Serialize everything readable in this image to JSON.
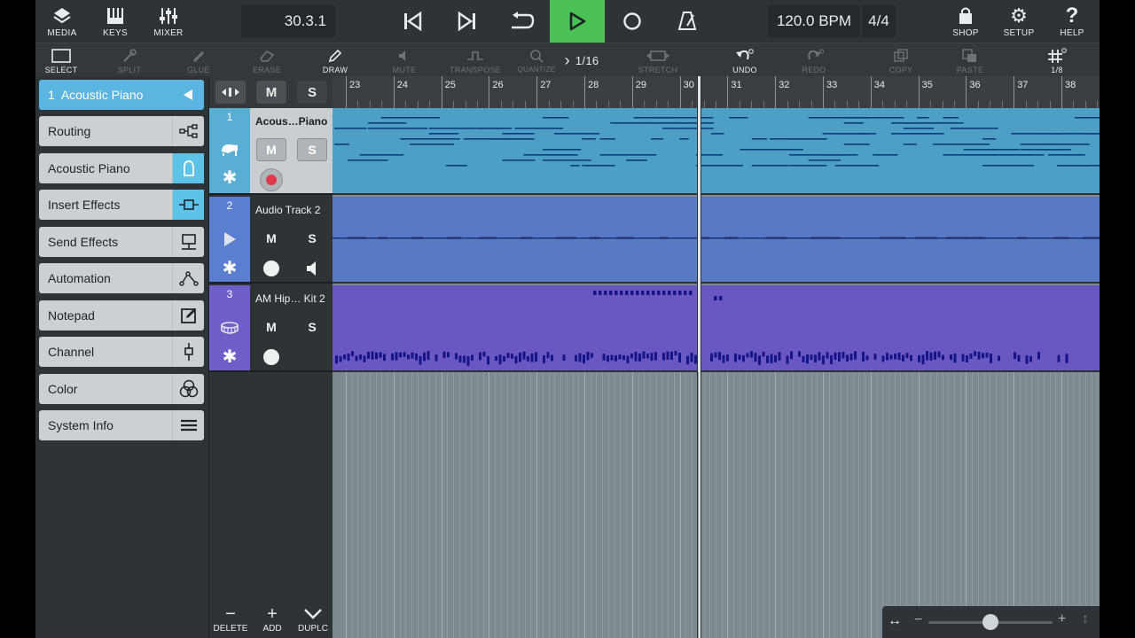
{
  "topbar": {
    "media": "MEDIA",
    "keys": "KEYS",
    "mixer": "MIXER",
    "position": "30.3.1",
    "tempo": "120.0 BPM",
    "signature": "4/4",
    "shop": "SHOP",
    "setup": "SETUP",
    "help": "HELP"
  },
  "toolbar": {
    "select": "SELECT",
    "split": "SPLIT",
    "glue": "GLUE",
    "erase": "ERASE",
    "draw": "DRAW",
    "mute": "MUTE",
    "transpose": "TRANSPOSE",
    "quantize": "QUANTIZE",
    "quantize_value": "1/16",
    "stretch": "STRETCH",
    "undo": "UNDO",
    "redo": "REDO",
    "copy": "COPY",
    "paste": "PASTE",
    "grid_value": "1/8"
  },
  "inspector": {
    "track_number": "1",
    "track_name": "Acoustic Piano",
    "items": [
      {
        "label": "Routing"
      },
      {
        "label": "Acoustic Piano"
      },
      {
        "label": "Insert Effects"
      },
      {
        "label": "Send Effects"
      },
      {
        "label": "Automation"
      },
      {
        "label": "Notepad"
      },
      {
        "label": "Channel"
      },
      {
        "label": "Color"
      },
      {
        "label": "System Info"
      }
    ]
  },
  "track_header": {
    "mute_all": "M",
    "solo_all": "S"
  },
  "tracks": [
    {
      "number": "1",
      "name": "Acous…Piano",
      "mute": "M",
      "solo": "S",
      "color": "#5aaed4"
    },
    {
      "number": "2",
      "name": "Audio Track 2",
      "mute": "M",
      "solo": "S",
      "color": "#5b7fd0"
    },
    {
      "number": "3",
      "name": "AM Hip… Kit 2",
      "mute": "M",
      "solo": "S",
      "color": "#6e5fc8"
    }
  ],
  "track_actions": {
    "delete": "DELETE",
    "add": "ADD",
    "duplicate": "DUPLC"
  },
  "ruler": {
    "bars": [
      "23",
      "24",
      "25",
      "26",
      "27",
      "28",
      "29",
      "30",
      "31",
      "32",
      "33",
      "34",
      "35",
      "36",
      "37",
      "38"
    ]
  },
  "colors": {
    "play_active": "#4bc157",
    "selected_track": "#5ab6e0",
    "piano_lane": "#4d9fc6",
    "audio_lane": "#5879c4",
    "drum_lane": "#6a58c0"
  }
}
